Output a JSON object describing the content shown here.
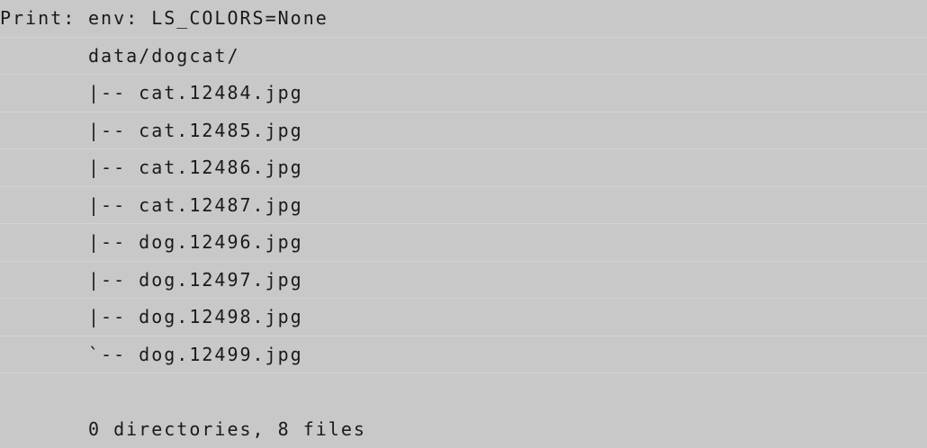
{
  "output": {
    "prefix": "Print:",
    "lines": [
      "env: LS_COLORS=None",
      "data/dogcat/",
      "|-- cat.12484.jpg",
      "|-- cat.12485.jpg",
      "|-- cat.12486.jpg",
      "|-- cat.12487.jpg",
      "|-- dog.12496.jpg",
      "|-- dog.12497.jpg",
      "|-- dog.12498.jpg",
      "`-- dog.12499.jpg",
      "",
      "0 directories, 8 files"
    ]
  }
}
